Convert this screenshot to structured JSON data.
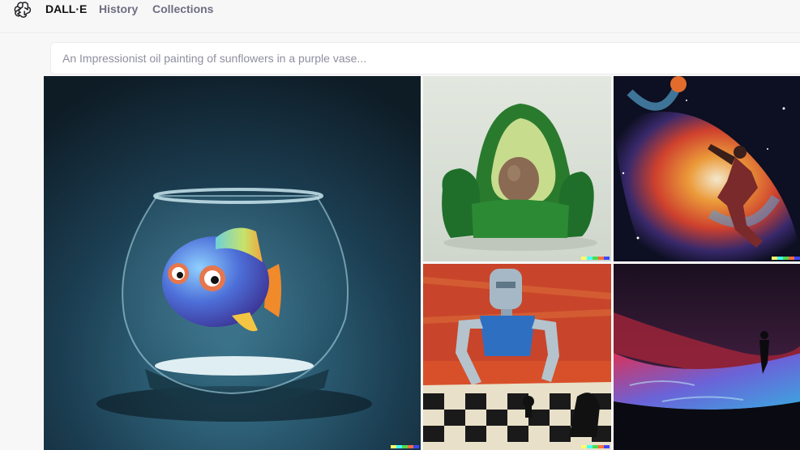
{
  "nav": {
    "logo_icon": "openai-logo-icon",
    "brand": "DALL·E",
    "history": "History",
    "collections": "Collections"
  },
  "prompt": {
    "placeholder": "An Impressionist oil painting of sunflowers in a purple vase...",
    "value": ""
  },
  "gallery": {
    "images": [
      "fish-in-bowl-image",
      "avocado-armchair-image",
      "space-basketball-image",
      "robot-chess-painting-image",
      "wave-silhouette-image"
    ],
    "signature_colors": [
      "#ffff66",
      "#42ffff",
      "#51da4c",
      "#ff6e3c",
      "#3c46ff"
    ]
  }
}
